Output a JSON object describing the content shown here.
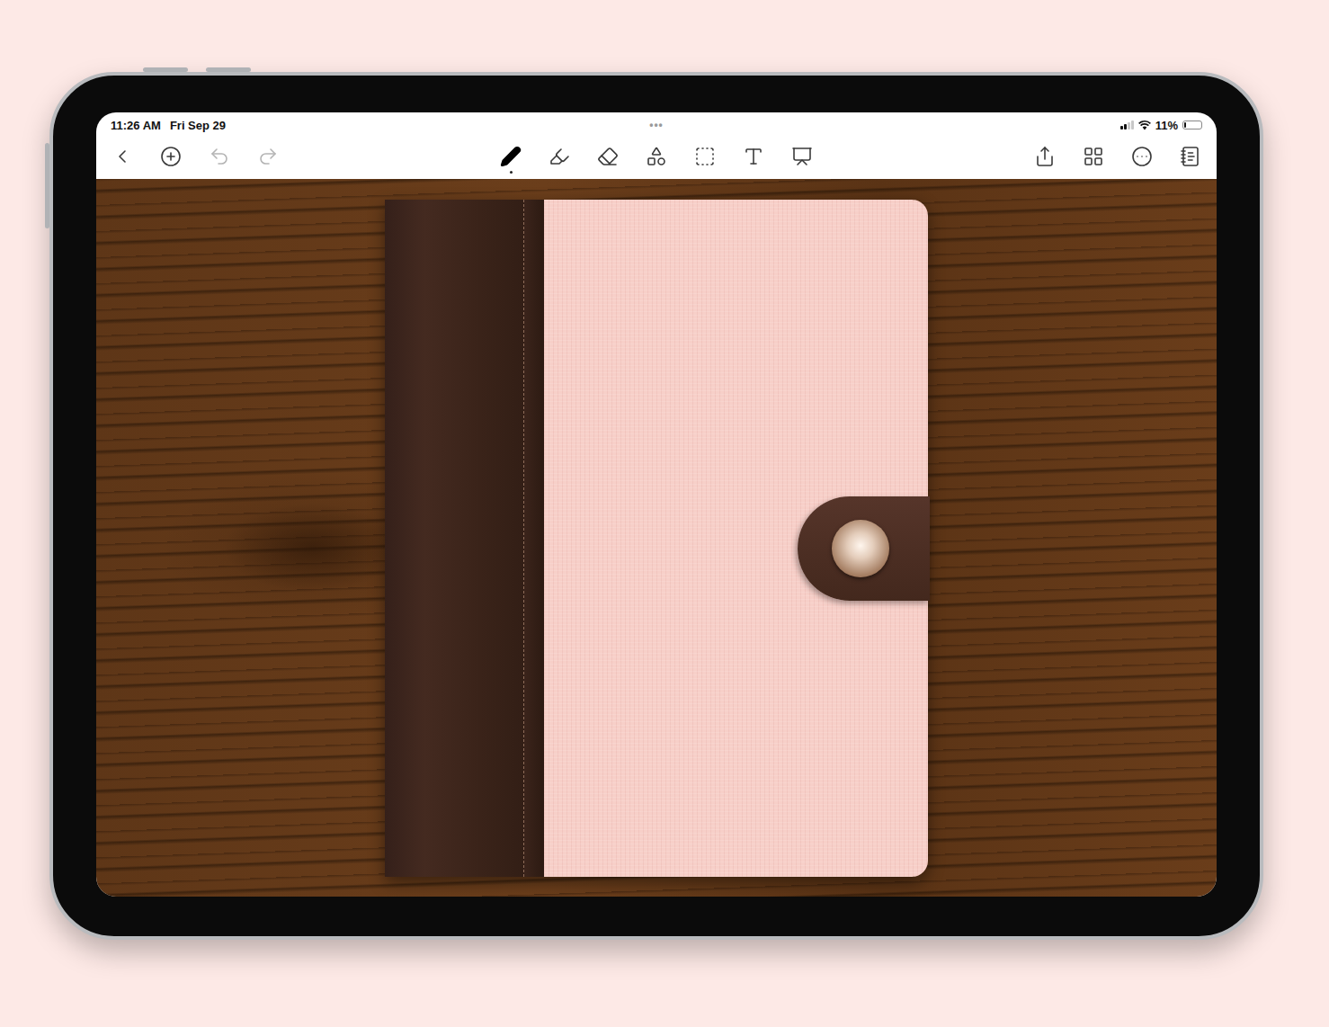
{
  "status_bar": {
    "time": "11:26 AM",
    "date": "Fri Sep 29",
    "dots": "•••",
    "battery": "11%",
    "battery_level": 0.11
  },
  "toolbar": {
    "left": [
      {
        "disabled": false
      },
      {
        "disabled": false
      },
      {
        "disabled": true
      },
      {
        "disabled": true
      }
    ],
    "tools": [
      {
        "selected": true
      },
      {
        "selected": false
      },
      {
        "selected": false
      },
      {
        "selected": false
      },
      {
        "selected": false
      },
      {
        "selected": false
      },
      {
        "selected": false
      }
    ]
  }
}
